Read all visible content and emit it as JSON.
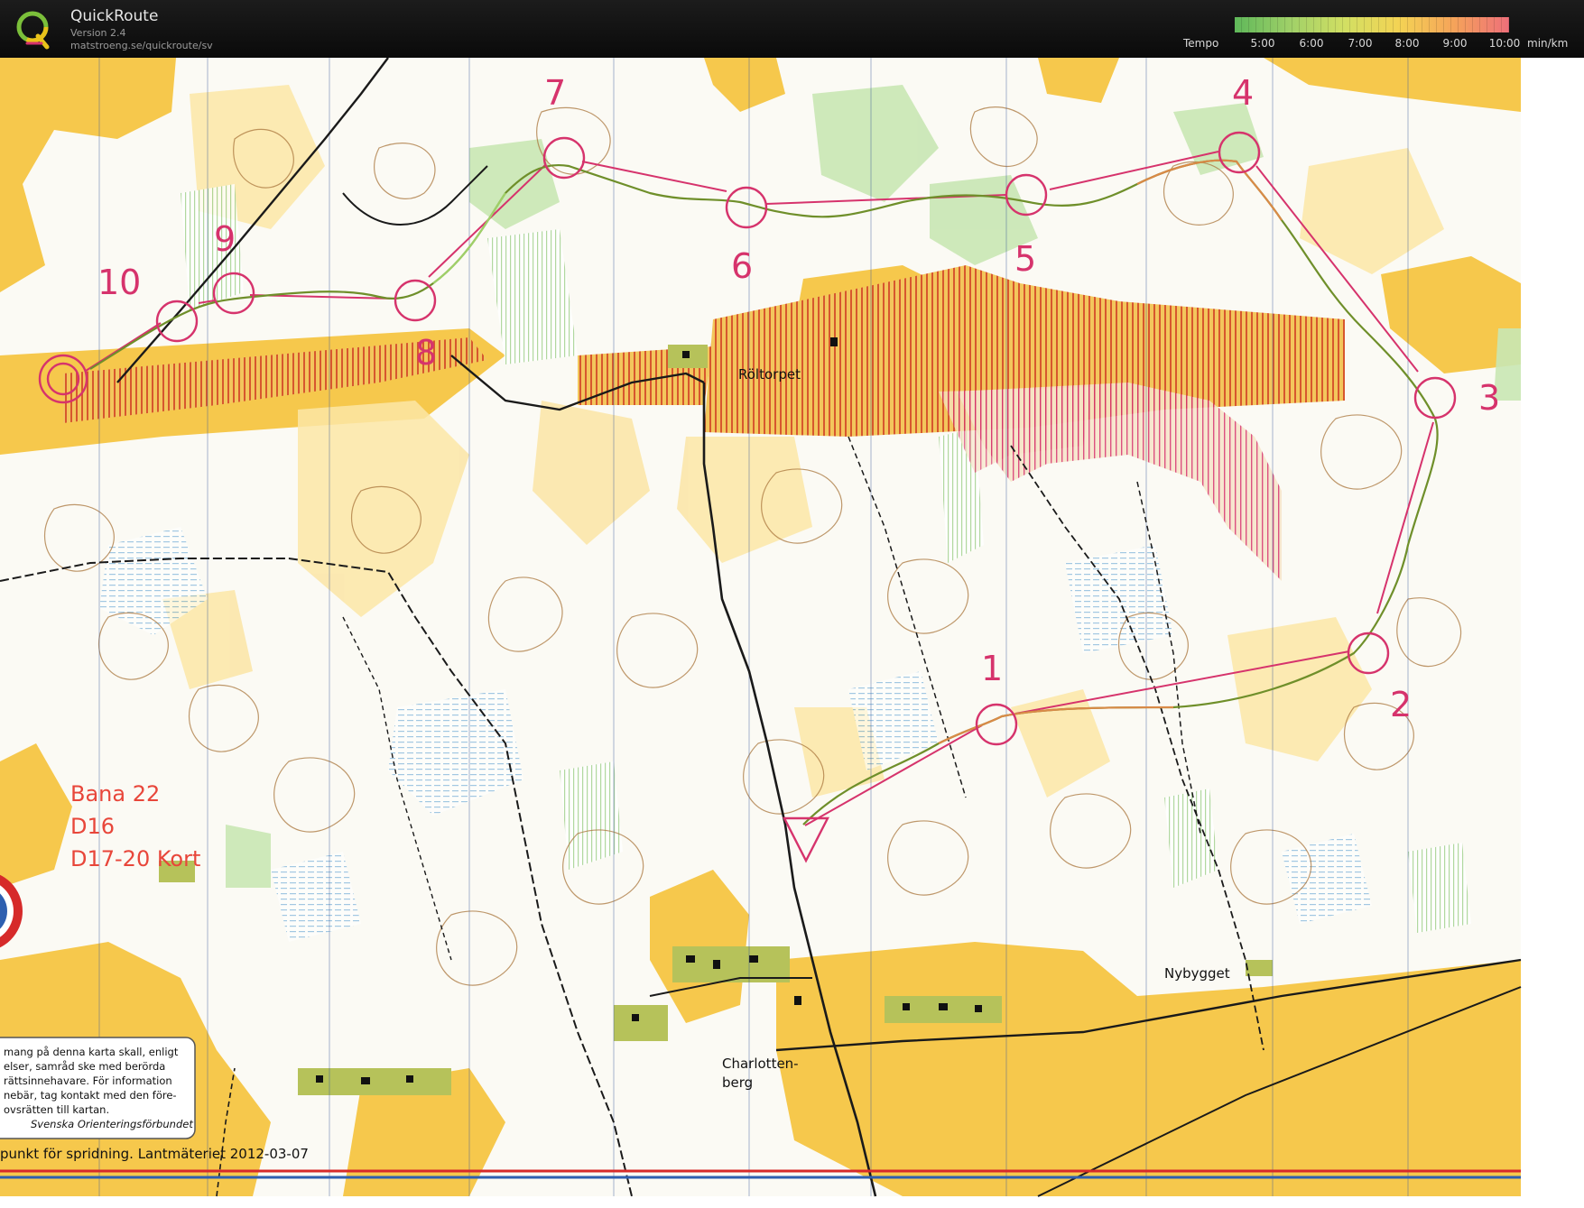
{
  "app": {
    "title": "QuickRoute",
    "version": "Version 2.4",
    "url": "matstroeng.se/quickroute/sv",
    "logo_letter": "Q"
  },
  "tempo": {
    "label": "Tempo",
    "ticks": [
      "5:00",
      "6:00",
      "7:00",
      "8:00",
      "9:00",
      "10:00"
    ],
    "unit": "min/km",
    "colors": [
      "#5fb85a",
      "#9fd068",
      "#d2df63",
      "#f4d354",
      "#f5a35a",
      "#ee6f7a"
    ]
  },
  "map": {
    "course_color": "#d6336c",
    "route_color": "#6f8f2a",
    "controls": [
      "1",
      "2",
      "3",
      "4",
      "5",
      "6",
      "7",
      "8",
      "9",
      "10"
    ],
    "place_names": {
      "roltorpet": "Röltorpet",
      "nybygget": "Nybygget",
      "charlottenberg_line1": "Charlotten-",
      "charlottenberg_line2": "berg"
    },
    "course_info": {
      "line1": "Bana 22",
      "line2": "D16",
      "line3": "D17-20 Kort"
    },
    "notice": {
      "line1": "mang på denna karta skall, enligt",
      "line2": "elser, samråd ske med berörda",
      "line3": "rättsinnehavare. För information",
      "line4": "nebär, tag kontakt med den före-",
      "line5": "ovsrätten till kartan.",
      "signature": "Svenska Orienteringsförbundet"
    },
    "footer": "punkt för spridning. Lantmäteriet 2012-03-07"
  }
}
